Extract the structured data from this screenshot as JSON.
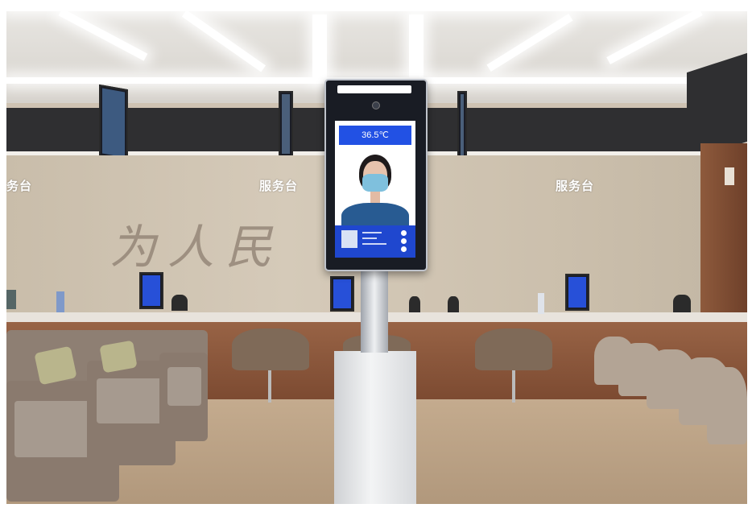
{
  "scene": {
    "counter_signs": [
      "务台",
      "服务台",
      "服务台"
    ],
    "wall_calligraphy": "为人民",
    "kiosk": {
      "temperature_reading": "36.5℃"
    }
  },
  "colors": {
    "kiosk_blue": "#2251e4",
    "counter_wood": "#8a5539",
    "wall": "#cfc3b0",
    "floor": "#bca183"
  }
}
